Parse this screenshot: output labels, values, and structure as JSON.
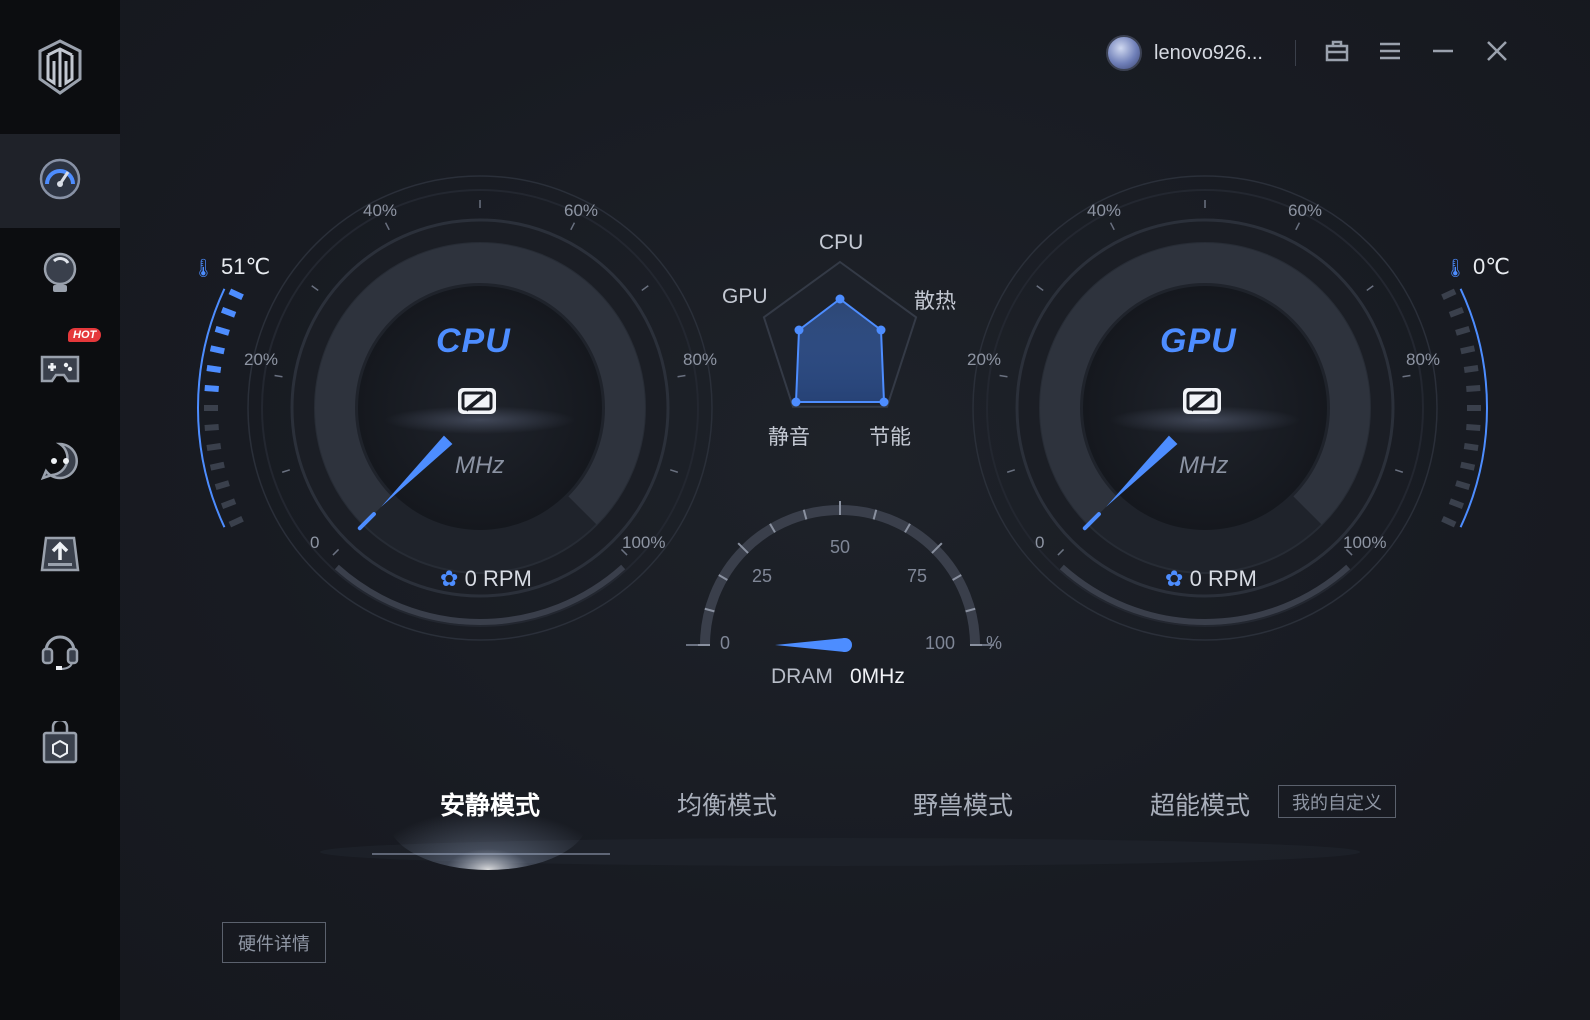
{
  "header": {
    "username": "lenovo926..."
  },
  "sidebar": {
    "hot_badge": "HOT",
    "items": [
      {
        "icon": "speedometer-icon",
        "active": true
      },
      {
        "icon": "lightbulb-icon"
      },
      {
        "icon": "gamepad-icon",
        "badge": "HOT"
      },
      {
        "icon": "chat-bot-icon"
      },
      {
        "icon": "upload-tray-icon"
      },
      {
        "icon": "headset-icon"
      },
      {
        "icon": "shopping-bag-icon"
      }
    ]
  },
  "cpu": {
    "title": "CPU",
    "unit": "MHz",
    "temperature": "51℃",
    "fan_value": "0",
    "fan_unit": "RPM",
    "load_percent": 0,
    "temp_level": 0.51,
    "scale": {
      "p0": "0",
      "p20": "20%",
      "p40": "40%",
      "p60": "60%",
      "p80": "80%",
      "p100": "100%"
    }
  },
  "gpu": {
    "title": "GPU",
    "unit": "MHz",
    "temperature": "0℃",
    "fan_value": "0",
    "fan_unit": "RPM",
    "load_percent": 0,
    "temp_level": 0.0,
    "scale": {
      "p0": "0",
      "p20": "20%",
      "p40": "40%",
      "p60": "60%",
      "p80": "80%",
      "p100": "100%"
    }
  },
  "radar": {
    "labels": {
      "cpu": "CPU",
      "cooling": "散热",
      "energy": "节能",
      "silent": "静音",
      "gpu": "GPU"
    }
  },
  "dram": {
    "label": "DRAM",
    "value": "0MHz",
    "scale": {
      "s0": "0",
      "s25": "25",
      "s50": "50",
      "s75": "75",
      "s100": "100",
      "unit": "%"
    },
    "usage_percent": 0
  },
  "modes": {
    "quiet": "安静模式",
    "balanced": "均衡模式",
    "beast": "野兽模式",
    "extreme": "超能模式",
    "active": "quiet",
    "custom_label": "我的自定义"
  },
  "hardware_details_label": "硬件详情",
  "colors": {
    "accent": "#4d8dff",
    "sidebar_bg": "#0c0d10",
    "main_bg": "#181b22"
  }
}
